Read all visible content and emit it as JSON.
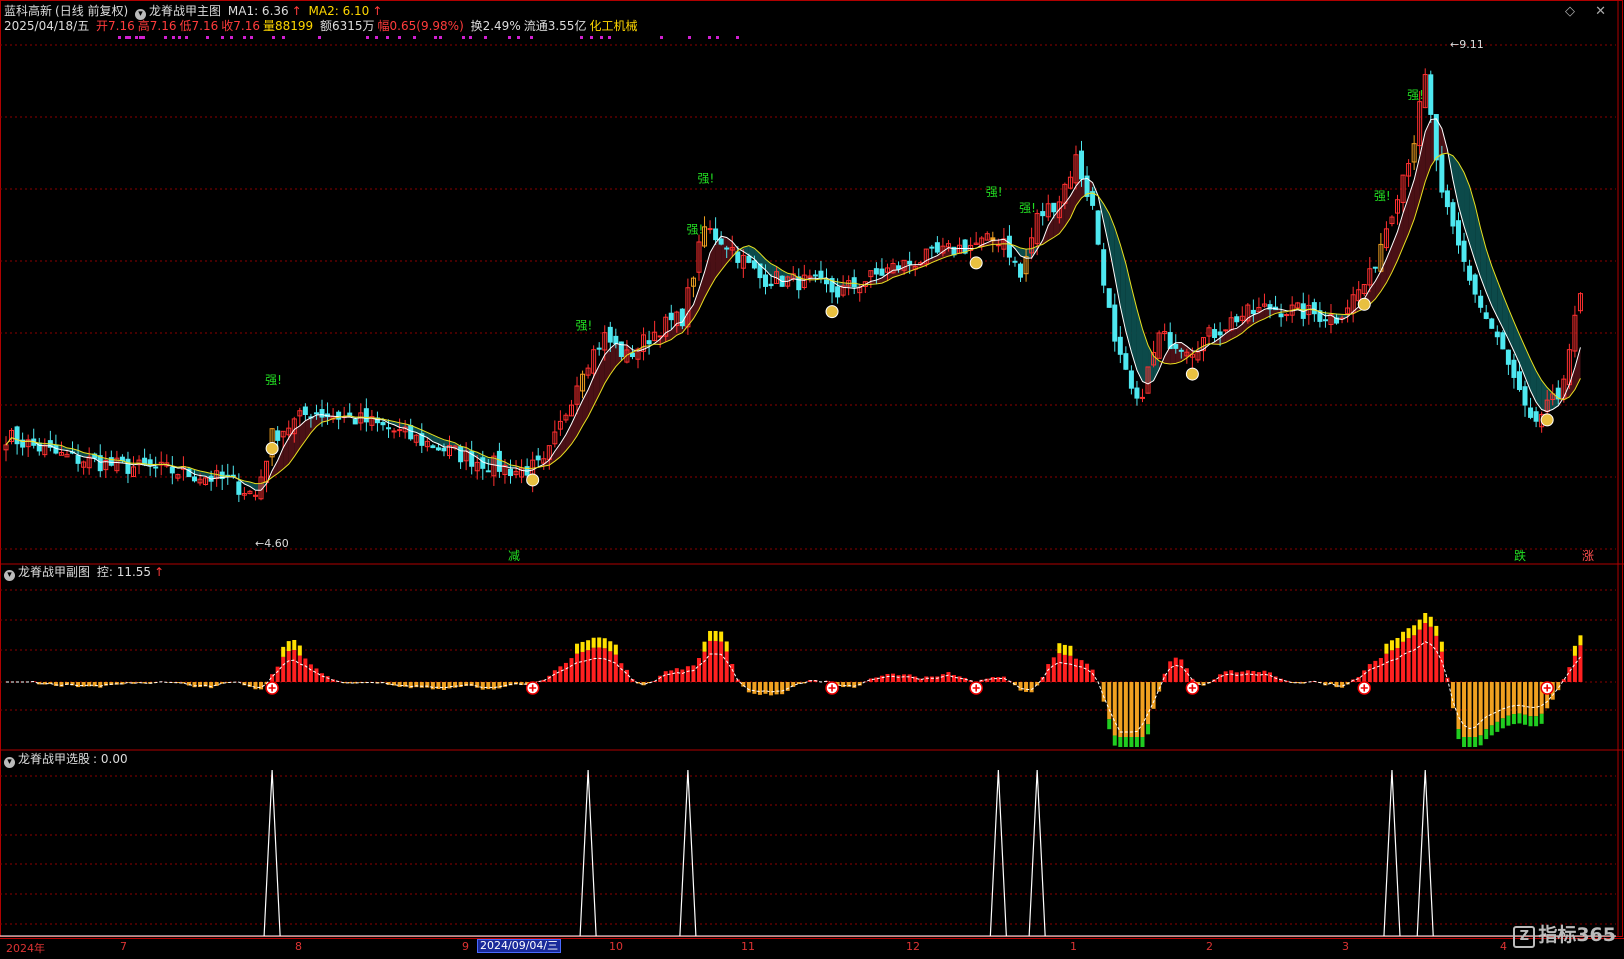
{
  "main_header": {
    "stock_name": "蓝科高新",
    "period": "(日线 前复权)",
    "indicator": "龙脊战甲主图",
    "ma1_label": "MA1: 6.36",
    "ma1_arrow": "↑",
    "ma2_label": "MA2: 6.10",
    "ma2_arrow": "↑"
  },
  "quote_line": {
    "date": "2025/04/18/五",
    "open": "开7.16",
    "high": "高7.16",
    "low": "低7.16",
    "close": "收7.16",
    "volume": "量88199",
    "amount": "额6315万",
    "change": "幅0.65(9.98%)",
    "turnover": "换2.49%",
    "float_cap": "流通3.55亿",
    "industry": "化工机械"
  },
  "top_icons": "◇ ✕",
  "sub1_header": {
    "title": "龙脊战甲副图",
    "value": "控: 11.55",
    "arrow": "↑"
  },
  "sub2_header": {
    "title": "龙脊战甲选股",
    "value": ": 0.00"
  },
  "annotations": {
    "low_price": "←4.60",
    "high_price": "←9.11",
    "strong": "强!",
    "reduce": "减",
    "fall": "跌",
    "rise": "涨"
  },
  "x_axis": {
    "labels": [
      "2024年",
      "7",
      "8",
      "9",
      "10",
      "11",
      "12",
      "1",
      "2",
      "3",
      "4"
    ],
    "selected_date": "2024/09/04/三"
  },
  "watermark": "指标365",
  "watermark_icon": "Z",
  "colors": {
    "up": "#ff3030",
    "down": "#4ee8f0",
    "ma1": "#ffffff",
    "ma2": "#e8e020",
    "ribbon_up": "#4a1015",
    "ribbon_down": "#0c4a4a",
    "strong": "#22dd22",
    "grid": "#8b0000",
    "signal_dots": "#d020d0",
    "money_bag": "#e8c040",
    "sub_red": "#ff2020",
    "sub_yellow": "#ffe000",
    "sub_orange": "#f0a020",
    "sub_green": "#20cc20"
  },
  "chart_data": [
    {
      "type": "candlestick",
      "title": "龙脊战甲主图",
      "x_start": "2024年",
      "x_end": "2025/04/18",
      "ylim": [
        4.3,
        9.4
      ],
      "series": [
        {
          "name": "MA1",
          "last": 6.36
        },
        {
          "name": "MA2",
          "last": 6.1
        }
      ],
      "price_path": [
        [
          0,
          5.3
        ],
        [
          10,
          5.1
        ],
        [
          20,
          5.0
        ],
        [
          30,
          4.95
        ],
        [
          40,
          4.85
        ],
        [
          45,
          4.7
        ],
        [
          48,
          5.3
        ],
        [
          55,
          5.55
        ],
        [
          65,
          5.45
        ],
        [
          75,
          5.25
        ],
        [
          85,
          5.05
        ],
        [
          92,
          4.95
        ],
        [
          97,
          5.0
        ],
        [
          100,
          5.4
        ],
        [
          104,
          6.0
        ],
        [
          108,
          6.3
        ],
        [
          112,
          6.1
        ],
        [
          118,
          6.4
        ],
        [
          122,
          6.5
        ],
        [
          126,
          7.4
        ],
        [
          130,
          7.25
        ],
        [
          136,
          6.9
        ],
        [
          145,
          6.85
        ],
        [
          150,
          6.75
        ],
        [
          160,
          7.0
        ],
        [
          172,
          7.2
        ],
        [
          180,
          7.3
        ],
        [
          183,
          6.9
        ],
        [
          186,
          7.5
        ],
        [
          190,
          7.7
        ],
        [
          193,
          8.1
        ],
        [
          196,
          7.6
        ],
        [
          200,
          6.2
        ],
        [
          204,
          5.6
        ],
        [
          208,
          6.3
        ],
        [
          214,
          6.2
        ],
        [
          222,
          6.5
        ],
        [
          228,
          6.6
        ],
        [
          234,
          6.55
        ],
        [
          240,
          6.5
        ],
        [
          246,
          6.9
        ],
        [
          250,
          7.6
        ],
        [
          254,
          8.3
        ],
        [
          256,
          8.9
        ],
        [
          259,
          7.7
        ],
        [
          262,
          7.2
        ],
        [
          266,
          6.6
        ],
        [
          270,
          6.15
        ],
        [
          275,
          5.4
        ],
        [
          280,
          5.7
        ],
        [
          284,
          6.7
        ]
      ],
      "total_bars": 285,
      "high_label": 9.11,
      "low_label": 4.6,
      "strong_signals_at": [
        48,
        104,
        124,
        126,
        178,
        184,
        248,
        254
      ],
      "money_bags_at": [
        48,
        95,
        149,
        175,
        214,
        245,
        278
      ]
    },
    {
      "type": "bar",
      "title": "龙脊战甲副图",
      "series": [
        {
          "name": "控",
          "last": 11.55
        }
      ]
    },
    {
      "type": "line",
      "title": "龙脊战甲选股",
      "series": [
        {
          "name": "龙脊战甲选股",
          "last": 0.0
        }
      ],
      "ylim": [
        0,
        1
      ],
      "spikes_at": [
        48,
        105,
        123,
        179,
        186,
        250,
        256
      ]
    }
  ]
}
